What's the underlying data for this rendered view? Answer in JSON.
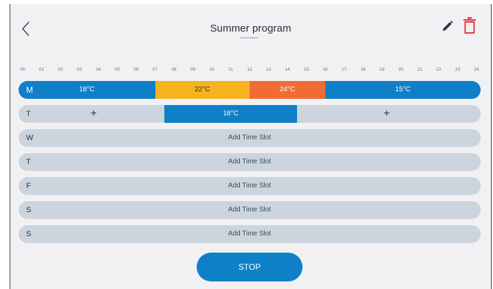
{
  "header": {
    "title": "Summer program",
    "back_icon": "chevron-left-icon",
    "edit_icon": "pencil-icon",
    "delete_icon": "trash-icon",
    "colors": {
      "delete": "#e8363d",
      "accent": "#0f80c8",
      "underline": "#a8c9e3"
    }
  },
  "hours": [
    "00",
    "01",
    "02",
    "03",
    "04",
    "05",
    "06",
    "07",
    "08",
    "09",
    "10",
    "11",
    "12",
    "13",
    "14",
    "15",
    "16",
    "17",
    "18",
    "19",
    "20",
    "21",
    "22",
    "23",
    "24"
  ],
  "days": [
    {
      "label": "M",
      "segments": [
        {
          "start": 0,
          "end": 7,
          "temp": "18°C",
          "color": "#0f80c8",
          "text_color": "#ffffff"
        },
        {
          "start": 7,
          "end": 12,
          "temp": "22°C",
          "color": "#f6b21f",
          "text_color": "#2b2b2b"
        },
        {
          "start": 12,
          "end": 16,
          "temp": "24°C",
          "color": "#f16b35",
          "text_color": "#ffffff"
        },
        {
          "start": 16,
          "end": 24,
          "temp": "15°C",
          "color": "#0f80c8",
          "text_color": "#ffffff"
        }
      ]
    },
    {
      "label": "T",
      "segments": [
        {
          "start": 7.5,
          "end": 14.5,
          "temp": "18°C",
          "color": "#0f80c8",
          "text_color": "#ffffff"
        }
      ],
      "plus_positions_hours": [
        3.75,
        19.25
      ],
      "plus_symbol": "+"
    },
    {
      "label": "W",
      "add_label": "Add Time Slot"
    },
    {
      "label": "T",
      "add_label": "Add Time Slot"
    },
    {
      "label": "F",
      "add_label": "Add Time Slot"
    },
    {
      "label": "S",
      "add_label": "Add Time Slot"
    },
    {
      "label": "S",
      "add_label": "Add Time Slot"
    }
  ],
  "actions": {
    "stop_label": "STOP"
  }
}
